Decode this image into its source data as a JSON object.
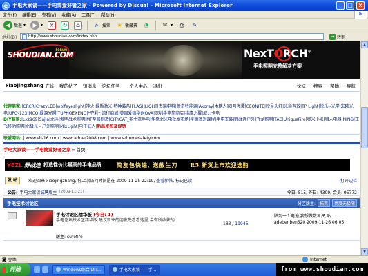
{
  "window": {
    "title": "手电大家谈——手电筒爱好者之家 - Powered by Discuz! - Microsoft Internet Explorer",
    "ie_glyph": "e"
  },
  "menubar": {
    "items": [
      "文件(F)",
      "编辑(E)",
      "查看(V)",
      "收藏(A)",
      "工具(T)",
      "帮助(H)"
    ]
  },
  "toolbar": {
    "back_label": "后退",
    "search_label": "搜索",
    "favorites_label": "收藏夹"
  },
  "address": {
    "label": "地址(D)",
    "url": "http://www.shoudian.com/index.php",
    "go_label": "转到"
  },
  "banner": {
    "logo_text": "SHOUDIAN.COM",
    "logo_sub": "FORUM",
    "nextorch_a": "NexT",
    "nextorch_o": "O",
    "nextorch_b": "RCH",
    "nextorch_reg": "®",
    "tagline": "手电照明完整解决方案"
  },
  "userbar": {
    "username": "xiaojingzhang",
    "status": "在线",
    "links": [
      "我的帖子",
      "短消息",
      "论坛任务",
      "个人中心",
      "退出"
    ],
    "right": [
      "论坛",
      "搜索",
      "帮助",
      "导航"
    ]
  },
  "links": {
    "dealer_label": "代理商家:",
    "dealer_items": "|CRCR|CrazyLED|wolfeyeslight|神火|绿盾激光|特种装备|FLASHLIGHT|杰瑞电科|新奇特能源|Akoray|木糖人家|月亮谭|CEONITE|映呈头灯|光影有效|TP Light|快乐--光学|宏欧光电|UFO-123|MCO|绿源光照|TUPHOEXENO|*夺彩*|流行商城|美国爱德华INOVA|深圳手电筒商店|猎鹰之翼|威力卡电",
    "diy_label": "DIY商家:",
    "diy_items": "|Lxz969|Sajia|北斗|傲明战术照明|MF至晨制造|CITYCAT_非主流手电|华盛北光电批发市场|星德激光课程|手电支装|野战连户外|飞龙照明|TAC|UniqueFire|奥米小米|猎人电器|NING|正飞移动照明|北极光 - 户外照明|MixLight|电子狂人|",
    "diy_tail": "新品发布及促销"
  },
  "urls": {
    "label": "联盟网站:",
    "items": "| www.vb-16.com | www.adder2008.com | www.szhomesafety.com"
  },
  "breadcrumb": {
    "site": "手电大家谈——手电筒爱好者之家",
    "sep": "»",
    "current": "首页"
  },
  "ad": {
    "brand_a": "YEZL",
    "brand_b": "野战连",
    "slogan": "打造性价比最高的手电品牌",
    "slogan2": "简友包快递, 送赦生刀",
    "promo": "R5 新货上市欢迎选购"
  },
  "welcome": {
    "post_button": "发 帖",
    "message": "欢迎回来  xiaojingzhang, 你上次访问时间是在  2009-11-25 22:19,",
    "new_posts_link": "查看新帖",
    "mark_read_link": "标记已读",
    "open_link": "打开边栏"
  },
  "notice": {
    "label": "公告:",
    "text": "手电大家谈诚聘版主",
    "date": "(2009-11-21)",
    "stats": "今日: 515, 昨日: 4309, 会员: 95772"
  },
  "category": {
    "name": "手电技术讨论区",
    "moderator_label": "分区版主:",
    "moderators": [
      "拓荒",
      "亮度无极限"
    ]
  },
  "forum": {
    "name": "手电讨论区精华板",
    "new_count": "(今日: 1)",
    "description": "手电论坛技术区精华版,建议新来的朋友先看看这里,会有所收获的",
    "moderator_label": "版主:",
    "moderator": "surefire",
    "counts": "183 / 19046",
    "last_post_title": "陆到一个电池,我想做数显尺,贴...",
    "last_post_user": "adebenben520",
    "last_post_time": "2009-11-26 06:05"
  },
  "statusbar": {
    "text": "完毕",
    "zone": "Internet"
  },
  "taskbar": {
    "start": "开始",
    "tasks": [
      "Windows综合 DIT...",
      "手电大家谈——手..."
    ]
  },
  "watermark": "from www.shoudian.com"
}
